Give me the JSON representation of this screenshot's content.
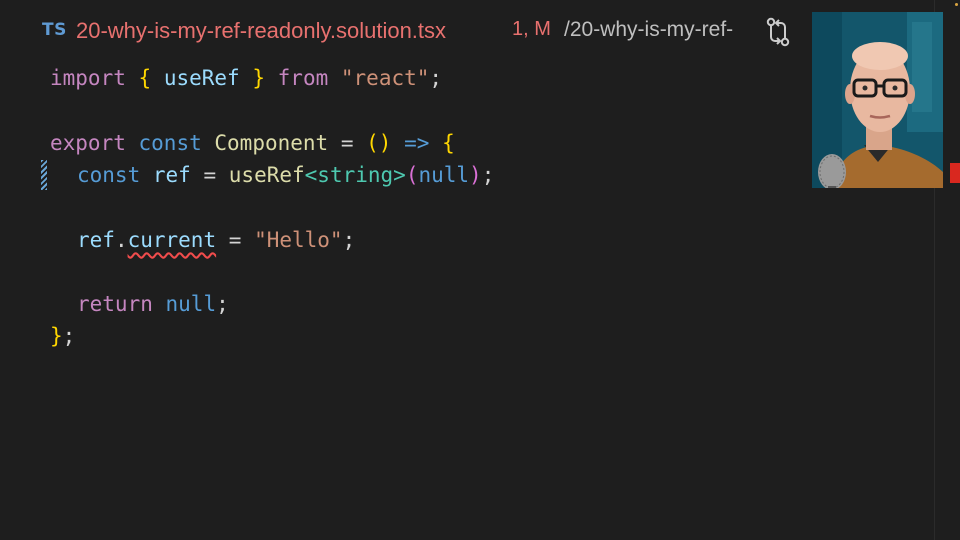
{
  "tab": {
    "language_badge": "TS",
    "file_name": "20-why-is-my-ref-readonly.solution.tsx",
    "status": "1, M",
    "breadcrumb": "/20-why-is-my-ref-"
  },
  "code": {
    "line1": {
      "kw": "import",
      "brace_open": "{",
      "name": "useRef",
      "brace_close": "}",
      "from": "from",
      "module": "\"react\"",
      "semi": ";"
    },
    "line3": {
      "export": "export",
      "const": "const",
      "name": "Component",
      "eq": "=",
      "parens": "()",
      "arrow": "=>",
      "brace": "{"
    },
    "line4": {
      "const": "const",
      "name": "ref",
      "eq": "=",
      "call": "useRef",
      "lt": "<",
      "type": "string",
      "gt": ">",
      "popen": "(",
      "null": "null",
      "pclose": ")",
      "semi": ";"
    },
    "line6": {
      "obj": "ref",
      "dot": ".",
      "prop": "current",
      "eq": "=",
      "value": "\"Hello\"",
      "semi": ";"
    },
    "line8": {
      "kw": "return",
      "null": "null",
      "semi": ";"
    },
    "line9": {
      "brace": "}",
      "semi": ";"
    }
  },
  "colors": {
    "background": "#1e1e1e",
    "file_modified": "#e8716f",
    "error_squiggle": "#f14c4c"
  },
  "icons": {
    "compare": "git-compare-icon",
    "webcam": "presenter-webcam"
  }
}
